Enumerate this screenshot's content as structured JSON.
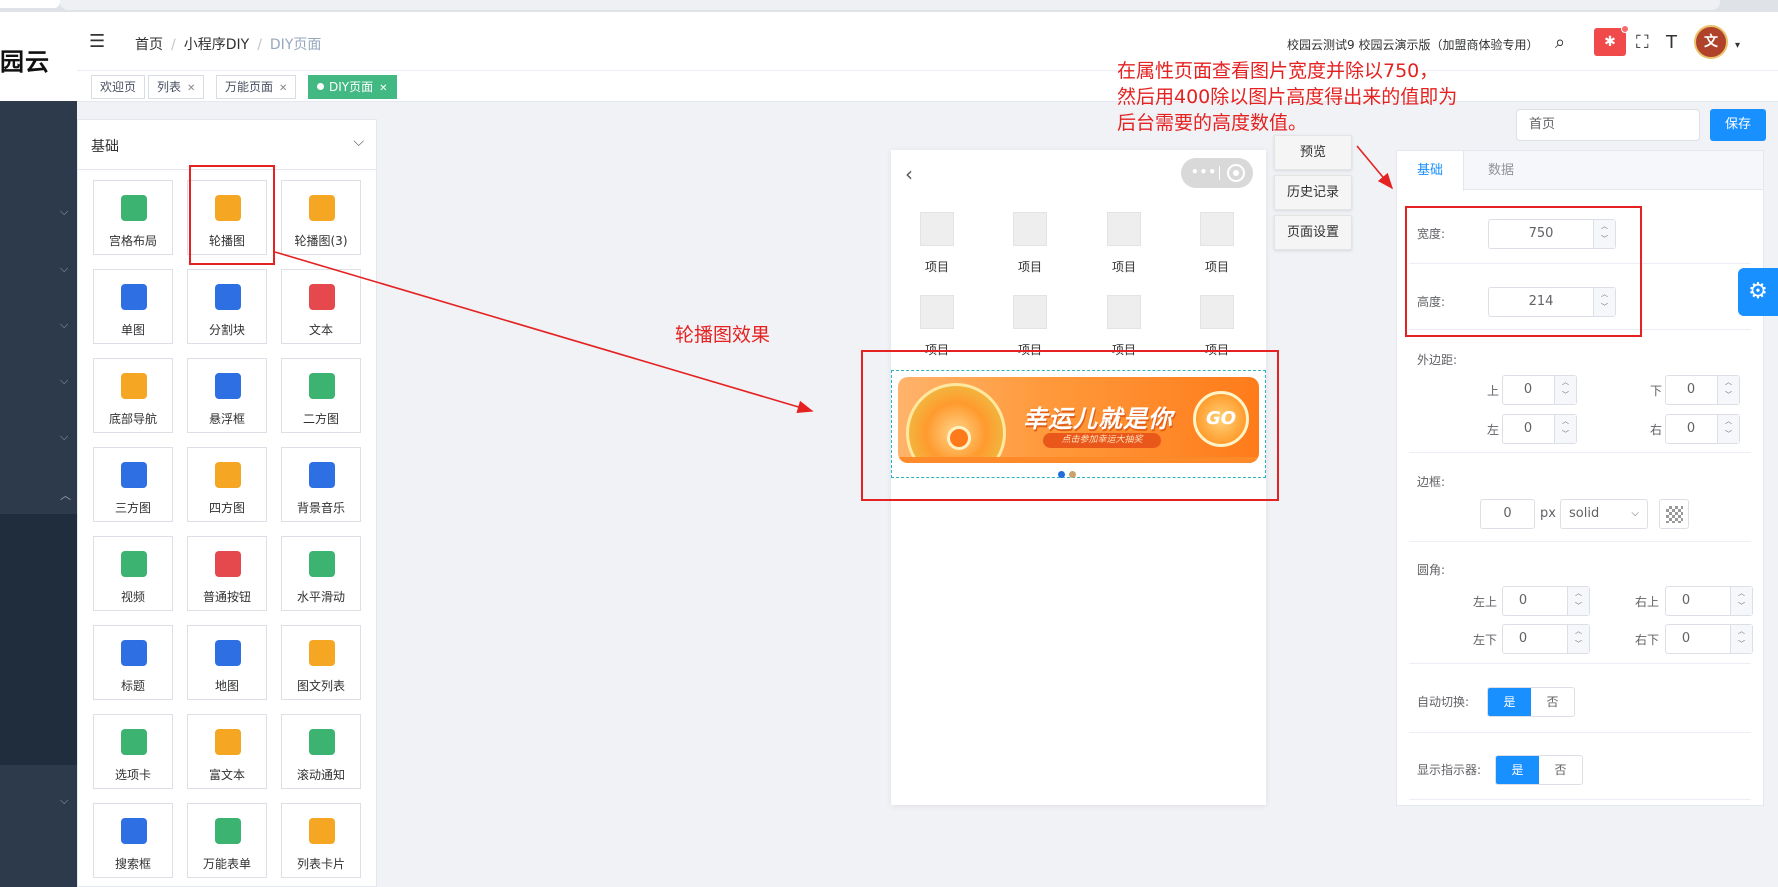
{
  "sidebar": {
    "logo": "园云"
  },
  "header": {
    "breadcrumb": [
      "首页",
      "小程序DIY",
      "DIY页面"
    ],
    "school": "校园云测试9 校园云演示版（加盟商体验专用）"
  },
  "tags": [
    {
      "label": "欢迎页",
      "closable": false,
      "active": false
    },
    {
      "label": "列表",
      "closable": true,
      "active": false
    },
    {
      "label": "万能页面",
      "closable": true,
      "active": false
    },
    {
      "label": "DIY页面",
      "closable": true,
      "active": true
    }
  ],
  "components": {
    "title": "基础",
    "items": [
      {
        "label": "宫格布局",
        "color": "#3cb371"
      },
      {
        "label": "轮播图",
        "color": "#f5a623"
      },
      {
        "label": "轮播图(3)",
        "color": "#f5a623"
      },
      {
        "label": "单图",
        "color": "#2f6fe4"
      },
      {
        "label": "分割块",
        "color": "#2f6fe4"
      },
      {
        "label": "文本",
        "color": "#e5484d"
      },
      {
        "label": "底部导航",
        "color": "#f5a623"
      },
      {
        "label": "悬浮框",
        "color": "#2f6fe4"
      },
      {
        "label": "二方图",
        "color": "#3cb371"
      },
      {
        "label": "三方图",
        "color": "#2f6fe4"
      },
      {
        "label": "四方图",
        "color": "#f5a623"
      },
      {
        "label": "背景音乐",
        "color": "#2f6fe4"
      },
      {
        "label": "视频",
        "color": "#3cb371"
      },
      {
        "label": "普通按钮",
        "color": "#e5484d"
      },
      {
        "label": "水平滑动",
        "color": "#3cb371"
      },
      {
        "label": "标题",
        "color": "#2f6fe4"
      },
      {
        "label": "地图",
        "color": "#2f6fe4"
      },
      {
        "label": "图文列表",
        "color": "#f5a623"
      },
      {
        "label": "选项卡",
        "color": "#3cb371"
      },
      {
        "label": "富文本",
        "color": "#f5a623"
      },
      {
        "label": "滚动通知",
        "color": "#3cb371"
      },
      {
        "label": "搜索框",
        "color": "#2f6fe4"
      },
      {
        "label": "万能表单",
        "color": "#3cb371"
      },
      {
        "label": "列表卡片",
        "color": "#f5a623"
      }
    ]
  },
  "phone": {
    "grid_items": [
      "项目",
      "项目",
      "项目",
      "项目",
      "项目",
      "项目",
      "项目",
      "项目"
    ],
    "banner_title": "幸运儿就是你",
    "banner_sub": "点击参加幸运大抽奖",
    "banner_go": "GO",
    "banner_dots": [
      "#1e6fd9",
      "#c9a46a"
    ]
  },
  "tools": [
    "预览",
    "历史记录",
    "页面设置"
  ],
  "page_title_input": "首页",
  "save_label": "保存",
  "props": {
    "tabs": [
      "基础",
      "数据"
    ],
    "width_label": "宽度:",
    "width_value": "750",
    "height_label": "高度:",
    "height_value": "214",
    "margin_label": "外边距:",
    "margin_top_label": "上",
    "margin_top": "0",
    "margin_bottom_label": "下",
    "margin_bottom": "0",
    "margin_left_label": "左",
    "margin_left": "0",
    "margin_right_label": "右",
    "margin_right": "0",
    "border_label": "边框:",
    "border_value": "0",
    "border_unit": "px",
    "border_style": "solid",
    "radius_label": "圆角:",
    "radius_tl_label": "左上",
    "radius_tl": "0",
    "radius_tr_label": "右上",
    "radius_tr": "0",
    "radius_bl_label": "左下",
    "radius_bl": "0",
    "radius_br_label": "右下",
    "radius_br": "0",
    "autoplay_label": "自动切换:",
    "indicator_label": "显示指示器:",
    "yes": "是",
    "no": "否"
  },
  "annotations": {
    "note_line1": "在属性页面查看图片宽度并除以750，",
    "note_line2": "然后用400除以图片高度得出来的值即为",
    "note_line3": "后台需要的高度数值。",
    "effect": "轮播图效果"
  },
  "colors": {
    "accent": "#1890ff",
    "annotation": "#e52222",
    "active_tag": "#42b983"
  }
}
